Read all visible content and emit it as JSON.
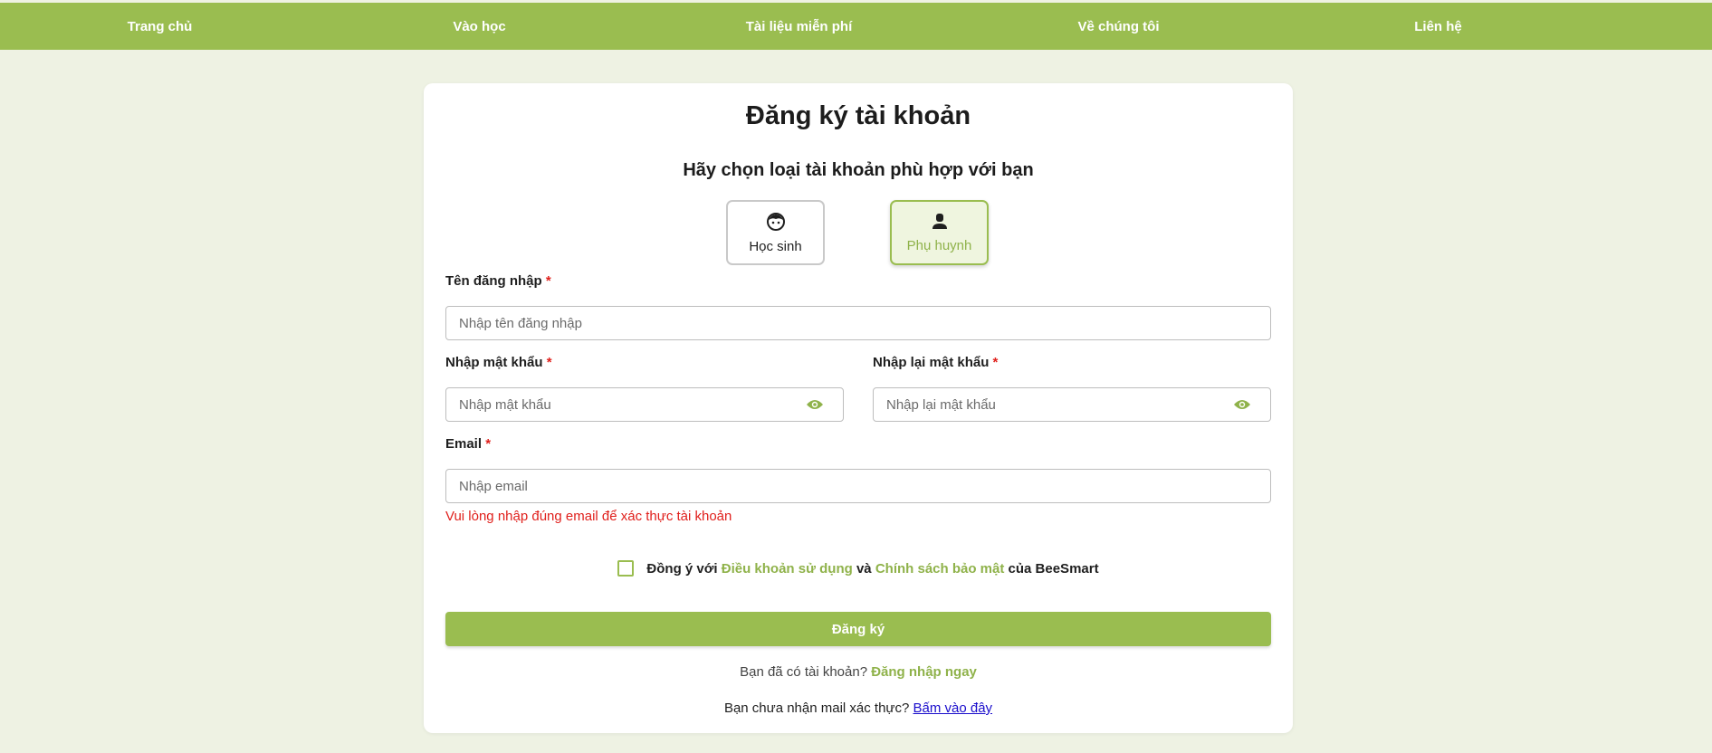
{
  "nav": {
    "items": [
      {
        "label": "Trang chủ"
      },
      {
        "label": "Vào học"
      },
      {
        "label": "Tài liệu miễn phí"
      },
      {
        "label": "Về chúng tôi"
      },
      {
        "label": "Liên hệ"
      }
    ]
  },
  "form": {
    "title": "Đăng ký tài khoản",
    "subtitle": "Hãy chọn loại tài khoản phù hợp với bạn",
    "account_types": [
      {
        "label": "Học sinh",
        "icon": "student-face-icon",
        "selected": false
      },
      {
        "label": "Phụ huynh",
        "icon": "parent-user-icon",
        "selected": true
      }
    ],
    "required_mark": "*",
    "username": {
      "label": "Tên đăng nhập",
      "placeholder": "Nhập tên đăng nhập",
      "value": ""
    },
    "password": {
      "label": "Nhập mật khẩu",
      "placeholder": "Nhập mật khẩu",
      "value": ""
    },
    "confirm_password": {
      "label": "Nhập lại mật khẩu",
      "placeholder": "Nhập lại mật khẩu",
      "value": ""
    },
    "email": {
      "label": "Email",
      "placeholder": "Nhập email",
      "value": "",
      "hint": "Vui lòng nhập đúng email để xác thực tài khoản"
    },
    "agreement": {
      "prefix": "Đồng ý với ",
      "terms_link": "Điều khoản sử dụng",
      "middle": " và ",
      "privacy_link": "Chính sách bảo mật",
      "suffix": " của BeeSmart",
      "checked": false
    },
    "submit_label": "Đăng ký",
    "login_prompt": {
      "text": "Bạn đã có tài khoản? ",
      "link": "Đăng nhập ngay"
    },
    "verify_prompt": {
      "text": "Bạn chưa nhận mail xác thực? ",
      "link": "Bấm vào đây"
    }
  },
  "colors": {
    "accent": "#9abd50",
    "background": "#eef2e3",
    "error": "#e0201c",
    "link_blue": "#1a0dcc"
  }
}
